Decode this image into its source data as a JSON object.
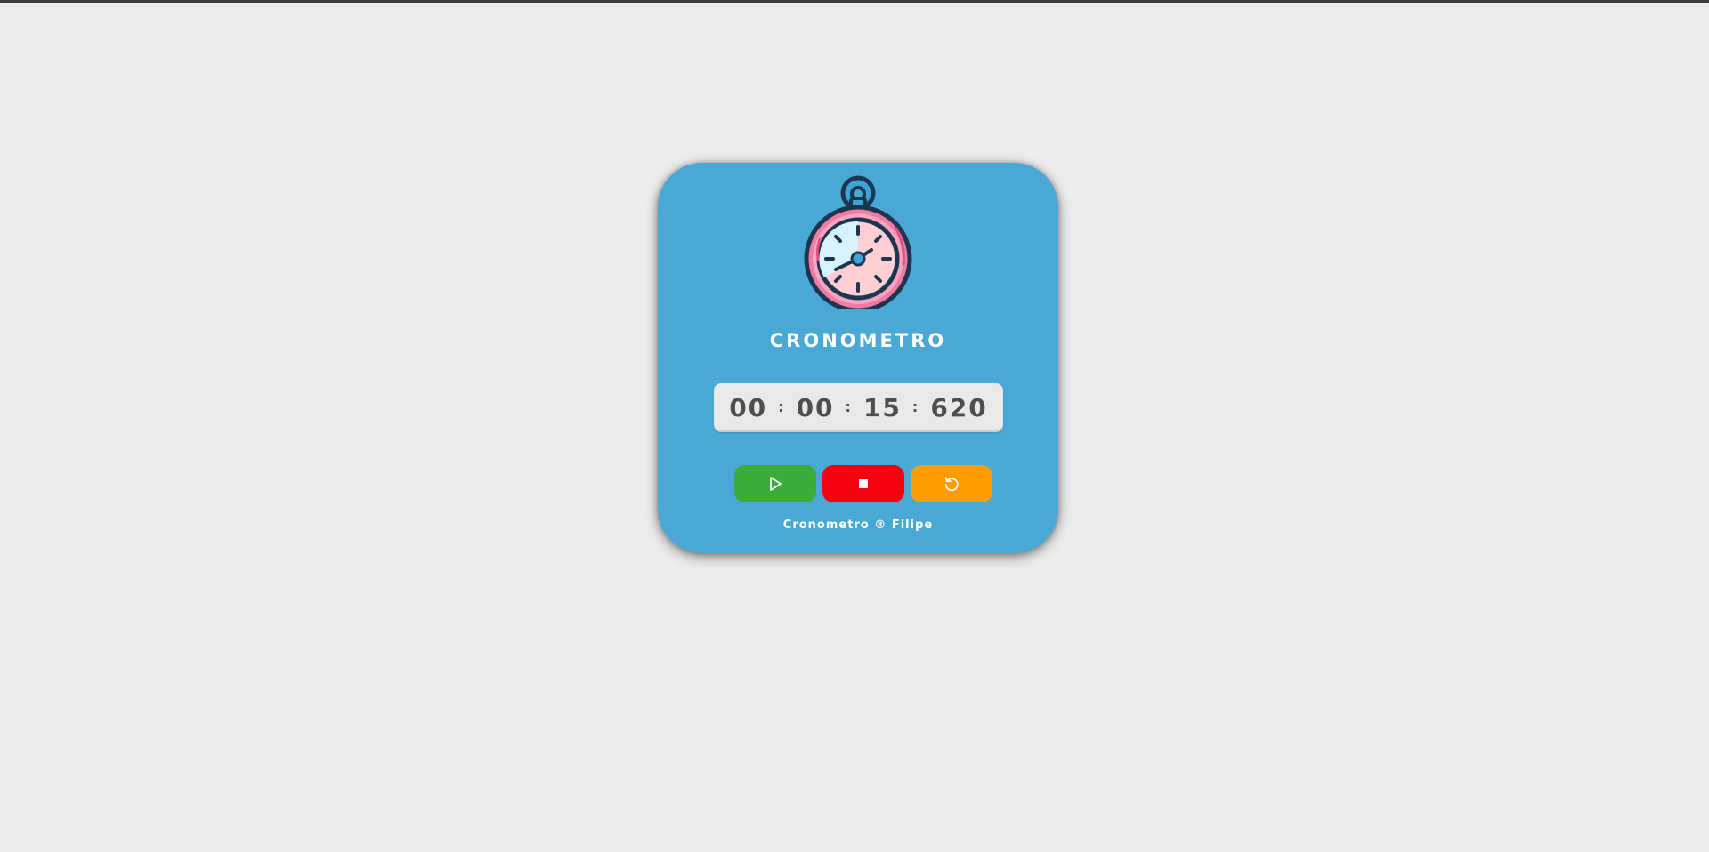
{
  "app": {
    "title": "CRONOMETRO",
    "logo_icon": "stopwatch-icon",
    "footer": "Cronometro ® Filipe"
  },
  "timer": {
    "hours": "00",
    "minutes": "00",
    "seconds": "15",
    "milliseconds": "620",
    "separator": ":"
  },
  "controls": {
    "start_icon": "play-icon",
    "stop_icon": "stop-icon",
    "reset_icon": "reset-icon"
  },
  "colors": {
    "background": "#edebeb",
    "card": "#4aa8d6",
    "display": "#e9e9ea",
    "start": "#3cab37",
    "stop": "#f5000e",
    "reset": "#ff9d00"
  }
}
